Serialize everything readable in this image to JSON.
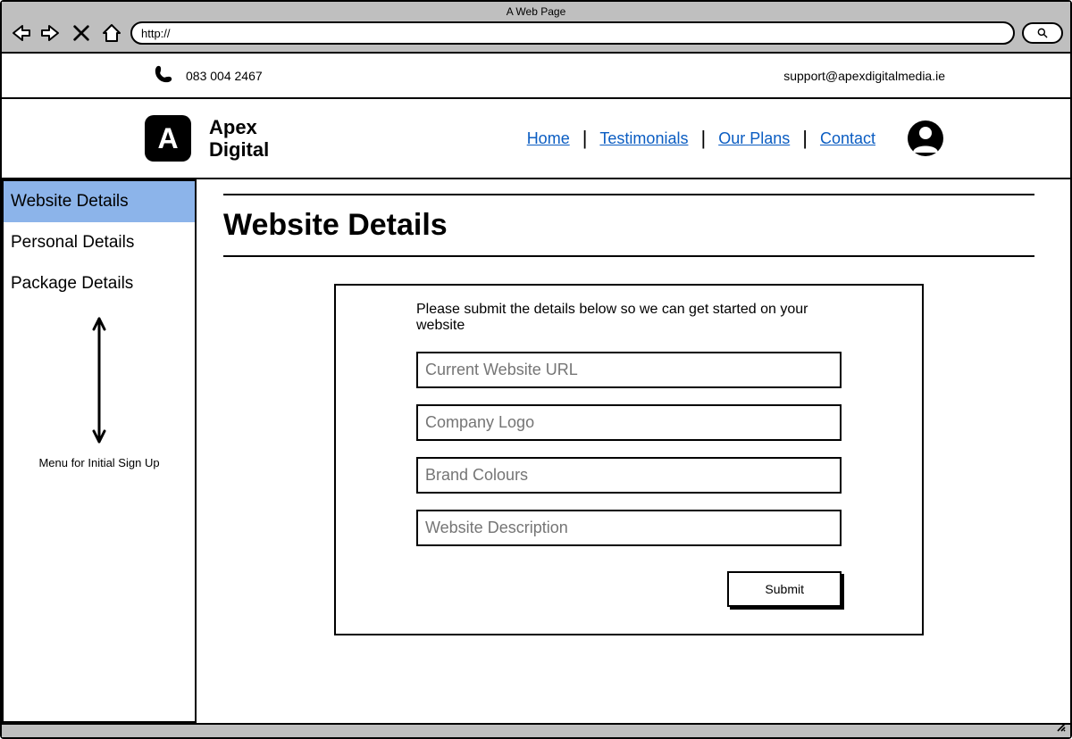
{
  "browser": {
    "title": "A Web Page",
    "url_prefix": "http://"
  },
  "topbar": {
    "phone": "083 004 2467",
    "email": "support@apexdigitalmedia.ie"
  },
  "header": {
    "brand_line1": "Apex",
    "brand_line2": "Digital",
    "nav": {
      "home": "Home",
      "testimonials": "Testimonials",
      "plans": "Our Plans",
      "contact": "Contact"
    }
  },
  "sidebar": {
    "items": [
      {
        "label": "Website Details",
        "active": true
      },
      {
        "label": "Personal Details",
        "active": false
      },
      {
        "label": "Package Details",
        "active": false
      }
    ],
    "caption": "Menu for Initial Sign Up"
  },
  "page": {
    "title": "Website Details",
    "form": {
      "instruction": "Please submit the details below so we can get started on your website",
      "fields": {
        "current_url": "Current Website URL",
        "company_logo": "Company Logo",
        "brand_colours": "Brand Colours",
        "website_description": "Website Description"
      },
      "submit_label": "Submit"
    }
  }
}
